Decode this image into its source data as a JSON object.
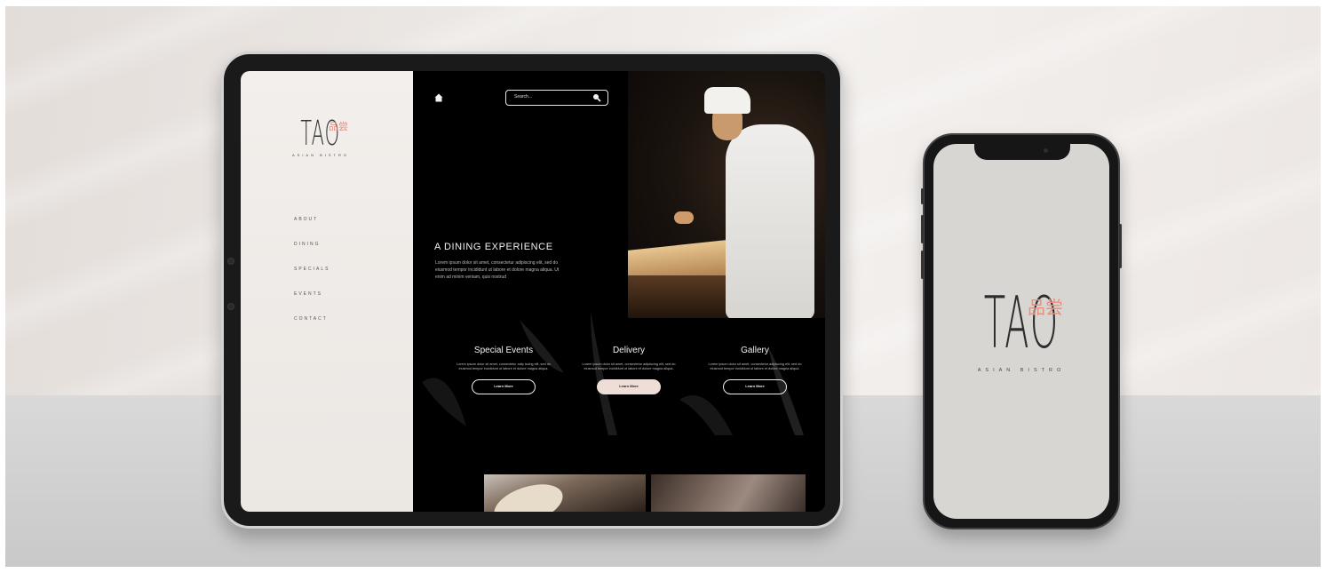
{
  "brand": {
    "logo_text": "TAO",
    "logo_kanji": "品尝",
    "subtitle": "ASIAN BISTRO",
    "accent_color": "#e08e80"
  },
  "sidebar": {
    "nav": [
      {
        "label": "ABOUT"
      },
      {
        "label": "DINING"
      },
      {
        "label": "SPECIALS"
      },
      {
        "label": "EVENTS"
      },
      {
        "label": "CONTACT"
      }
    ]
  },
  "header": {
    "home_icon": "home-icon",
    "search_placeholder": "Search...",
    "search_icon": "search-icon"
  },
  "hero": {
    "headline": "A DINING EXPERIENCE",
    "body": "Lorem ipsum dolor sit amet, consectetur adipiscing elit, sed do eiusmod tempor incididunt ut labore et dolore magna aliqua. Ut enim ad minim veniam, quis nostrud"
  },
  "cards": [
    {
      "title": "Special Events",
      "text": "Lorem ipsum dolor sit amet, consectetur adip iscing elit, sed do eiusmod tempor incididunt ut labore et dolore magna aliqua.",
      "button": "Learn More"
    },
    {
      "title": "Delivery",
      "text": "Lorem ipsum dolor sit amet, consectetur adipiscing elit, sed do eiusmod tempor incididunt ut labore et dolore magna aliqua.",
      "button": "Learn More"
    },
    {
      "title": "Gallery",
      "text": "Lorem ipsum dolor sit amet, consectetur adipiscing elit, sed do eiusmod tempor incididunt ut labore et dolore magna aliqua.",
      "button": "Learn More"
    }
  ],
  "phone": {
    "logo_text": "TAO",
    "logo_kanji": "品尝",
    "subtitle": "ASIAN BISTRO"
  }
}
